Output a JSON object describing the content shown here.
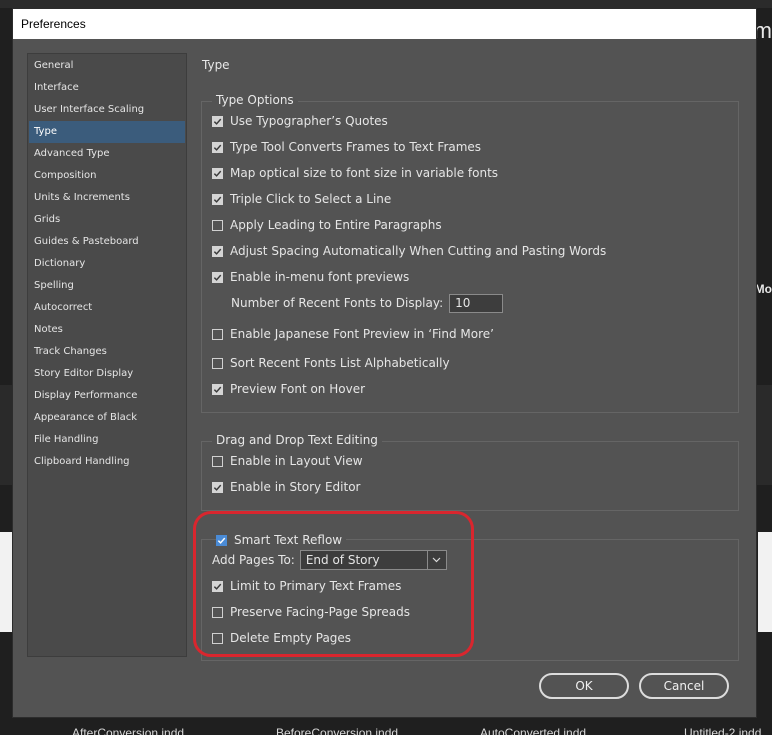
{
  "dialog": {
    "title": "Preferences"
  },
  "background": {
    "right_title": "m",
    "right_label": "Mo",
    "files": [
      "AfterConversion.indd",
      "BeforeConversion.indd",
      "AutoConverted.indd",
      "Untitled-2.indd"
    ]
  },
  "sidebar": {
    "items": [
      {
        "label": "General"
      },
      {
        "label": "Interface"
      },
      {
        "label": "User Interface Scaling"
      },
      {
        "label": "Type",
        "selected": true
      },
      {
        "label": "Advanced Type"
      },
      {
        "label": "Composition"
      },
      {
        "label": "Units & Increments"
      },
      {
        "label": "Grids"
      },
      {
        "label": "Guides & Pasteboard"
      },
      {
        "label": "Dictionary"
      },
      {
        "label": "Spelling"
      },
      {
        "label": "Autocorrect"
      },
      {
        "label": "Notes"
      },
      {
        "label": "Track Changes"
      },
      {
        "label": "Story Editor Display"
      },
      {
        "label": "Display Performance"
      },
      {
        "label": "Appearance of Black"
      },
      {
        "label": "File Handling"
      },
      {
        "label": "Clipboard Handling"
      }
    ]
  },
  "section": {
    "title": "Type"
  },
  "type_options": {
    "legend": "Type Options",
    "items": [
      {
        "label": "Use Typographer’s Quotes",
        "checked": true
      },
      {
        "label": "Type Tool Converts Frames to Text Frames",
        "checked": true
      },
      {
        "label": "Map optical size to font size in variable fonts",
        "checked": true
      },
      {
        "label": "Triple Click to Select a Line",
        "checked": true
      },
      {
        "label": "Apply Leading to Entire Paragraphs",
        "checked": false
      },
      {
        "label": "Adjust Spacing Automatically When Cutting and Pasting Words",
        "checked": true
      },
      {
        "label": "Enable in-menu font previews",
        "checked": true
      }
    ],
    "recent_fonts_label": "Number of Recent Fonts to Display:",
    "recent_fonts_value": "10",
    "items_after": [
      {
        "label": "Enable Japanese Font Preview in ‘Find More’",
        "checked": false
      },
      {
        "label": "Sort Recent Fonts List Alphabetically",
        "checked": false
      },
      {
        "label": "Preview Font on Hover",
        "checked": true
      }
    ]
  },
  "drag_drop": {
    "legend": "Drag and Drop Text Editing",
    "items": [
      {
        "label": "Enable in Layout View",
        "checked": false
      },
      {
        "label": "Enable in Story Editor",
        "checked": true
      }
    ]
  },
  "smart_reflow": {
    "label": "Smart Text Reflow",
    "checked": true,
    "add_pages_label": "Add Pages To:",
    "add_pages_value": "End of Story",
    "items": [
      {
        "label": "Limit to Primary Text Frames",
        "checked": true
      },
      {
        "label": "Preserve Facing-Page Spreads",
        "checked": false
      },
      {
        "label": "Delete Empty Pages",
        "checked": false
      }
    ]
  },
  "buttons": {
    "ok": "OK",
    "cancel": "Cancel"
  },
  "colors": {
    "accent": "#3b5c7c",
    "highlight": "#d9262e",
    "check_blue": "#4a8bd6"
  }
}
